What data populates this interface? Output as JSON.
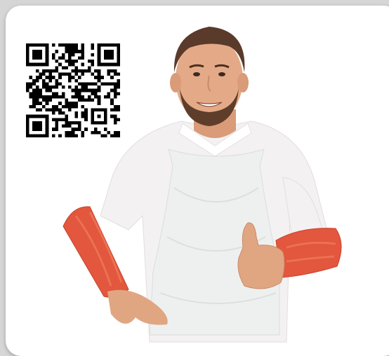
{
  "image": {
    "subject": "man-in-disposable-apron",
    "colors": {
      "card_background": "#ffffff",
      "page_background": "#d6d6d6",
      "sleeve": "#e2573e",
      "apron": "#eef0f0",
      "shirt": "#f4f1f3",
      "skin": "#e0a682",
      "hair": "#5a3a2a"
    },
    "icons": [
      "qr-code-icon",
      "thumbs-up-gesture"
    ]
  }
}
